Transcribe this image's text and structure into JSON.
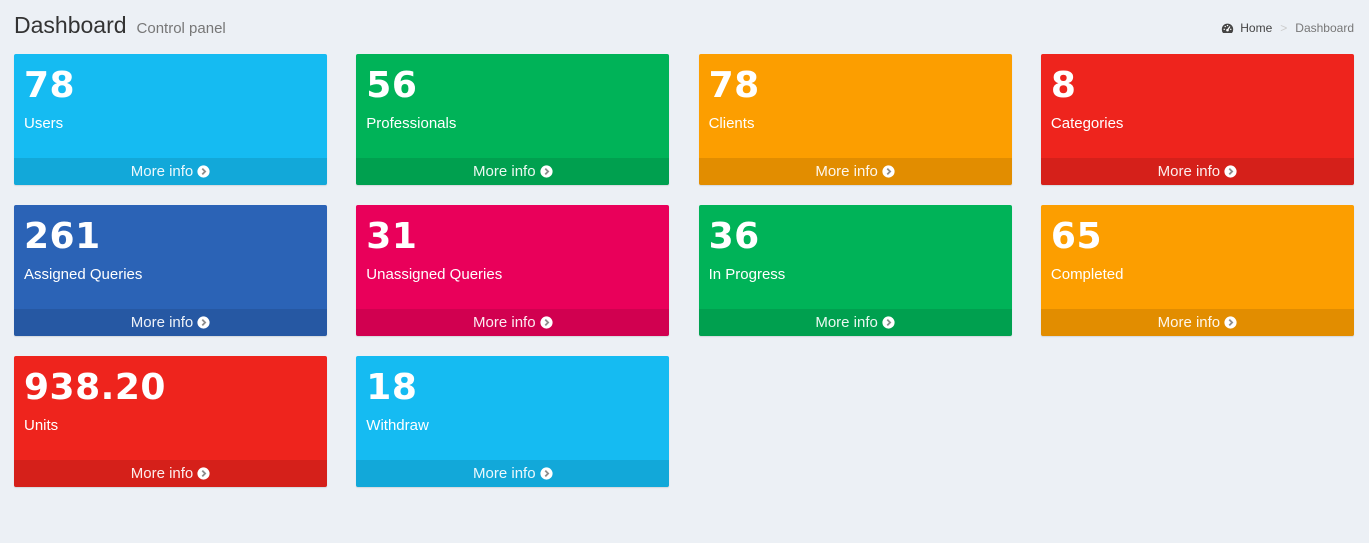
{
  "header": {
    "title": "Dashboard",
    "subtitle": "Control panel"
  },
  "breadcrumb": {
    "home_icon": "dashboard-icon",
    "home": "Home",
    "separator": ">",
    "current": "Dashboard"
  },
  "boxes": [
    {
      "value": "78",
      "label": "Users",
      "footer": "More info",
      "color": "#15bbf2"
    },
    {
      "value": "56",
      "label": "Professionals",
      "footer": "More info",
      "color": "#00b358"
    },
    {
      "value": "78",
      "label": "Clients",
      "footer": "More info",
      "color": "#fc9e00"
    },
    {
      "value": "8",
      "label": "Categories",
      "footer": "More info",
      "color": "#ee241d"
    },
    {
      "value": "261",
      "label": "Assigned Queries",
      "footer": "More info",
      "color": "#2b63b6"
    },
    {
      "value": "31",
      "label": "Unassigned Queries",
      "footer": "More info",
      "color": "#e9005a"
    },
    {
      "value": "36",
      "label": "In Progress",
      "footer": "More info",
      "color": "#00b358"
    },
    {
      "value": "65",
      "label": "Completed",
      "footer": "More info",
      "color": "#fc9e00"
    },
    {
      "value": "938.20",
      "label": "Units",
      "footer": "More info",
      "color": "#ee241d"
    },
    {
      "value": "18",
      "label": "Withdraw",
      "footer": "More info",
      "color": "#15bbf2"
    }
  ],
  "footer_icon": "arrow-circle-right-icon"
}
